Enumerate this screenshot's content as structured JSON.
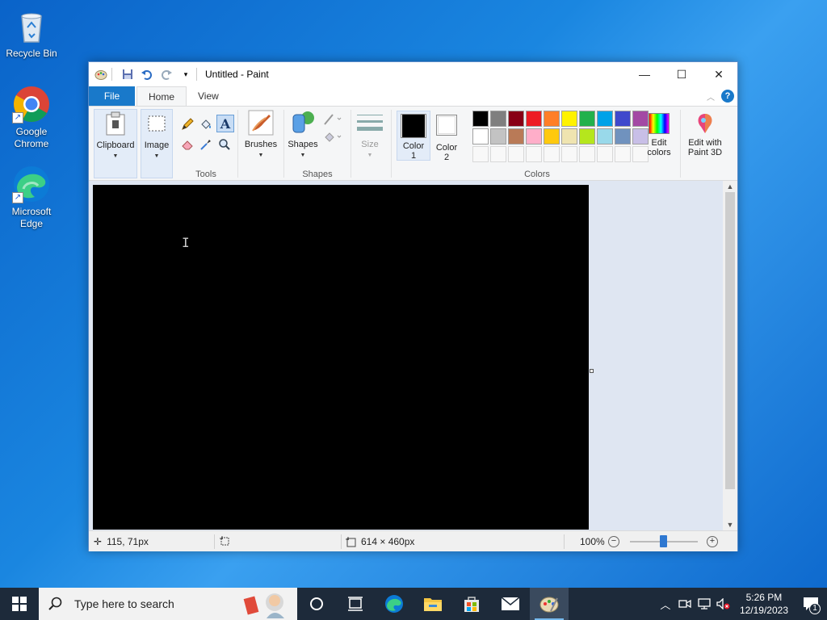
{
  "desktop": {
    "icons": [
      {
        "label": "Recycle Bin",
        "icon": "recycle-bin-icon"
      },
      {
        "label": "Google Chrome",
        "icon": "chrome-icon"
      },
      {
        "label": "Microsoft Edge",
        "icon": "edge-icon"
      }
    ]
  },
  "window": {
    "title": "Untitled - Paint",
    "controls": {
      "minimize": "—",
      "maximize": "☐",
      "close": "✕"
    }
  },
  "ribbon": {
    "tabs": [
      "File",
      "Home",
      "View"
    ],
    "help": "?",
    "groups": {
      "clipboard": {
        "label": "Clipboard"
      },
      "image": {
        "label": "Image"
      },
      "tools": {
        "label": "Tools"
      },
      "brushes": {
        "label": "Brushes"
      },
      "shapes": {
        "label": "Shapes",
        "button": "Shapes"
      },
      "size": {
        "label": "Size"
      },
      "color1": {
        "line1": "Color",
        "line2": "1",
        "value": "#000000"
      },
      "color2": {
        "line1": "Color",
        "line2": "2",
        "value": "#ffffff"
      },
      "colors": {
        "label": "Colors",
        "row1": [
          "#000000",
          "#7f7f7f",
          "#880015",
          "#ed1c24",
          "#ff7f27",
          "#fff200",
          "#22b14c",
          "#00a2e8",
          "#3f48cc",
          "#a349a4"
        ],
        "row2": [
          "#ffffff",
          "#c3c3c3",
          "#b97a57",
          "#ffaec9",
          "#ffc90e",
          "#efe4b0",
          "#b5e61d",
          "#99d9ea",
          "#7092be",
          "#c8bfe7"
        ]
      },
      "edit_colors": {
        "line1": "Edit",
        "line2": "colors"
      },
      "paint3d": {
        "line1": "Edit with",
        "line2": "Paint 3D"
      }
    }
  },
  "status": {
    "cursor_pos": "115, 71px",
    "canvas_size": "614 × 460px",
    "zoom": "100%"
  },
  "taskbar": {
    "search_placeholder": "Type here to search",
    "time": "5:26 PM",
    "date": "12/19/2023",
    "notification_count": "1"
  }
}
